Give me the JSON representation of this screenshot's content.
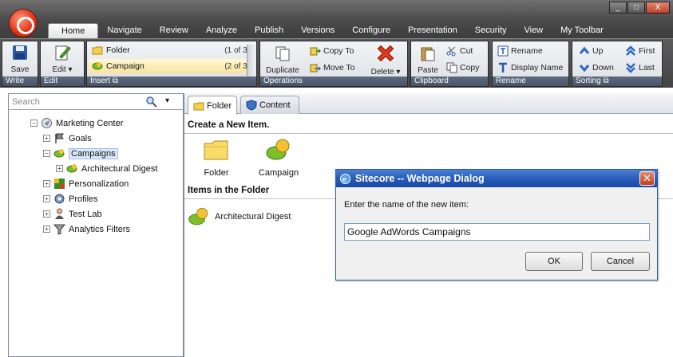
{
  "window": {
    "controls": [
      "_",
      "□",
      "X"
    ]
  },
  "tabs": [
    "Home",
    "Navigate",
    "Review",
    "Analyze",
    "Publish",
    "Versions",
    "Configure",
    "Presentation",
    "Security",
    "View",
    "My Toolbar"
  ],
  "ribbon": {
    "write": {
      "save_label": "Save",
      "footer": "Write"
    },
    "edit": {
      "edit_label": "Edit",
      "footer": "Edit"
    },
    "insert": {
      "footer": "Insert",
      "items": [
        {
          "label": "Folder",
          "count": "(1 of 3)"
        },
        {
          "label": "Campaign",
          "count": "(2 of 3)"
        }
      ]
    },
    "operations": {
      "footer": "Operations",
      "duplicate": "Duplicate",
      "copy_to": "Copy To",
      "move_to": "Move To",
      "delete": "Delete"
    },
    "clipboard": {
      "footer": "Clipboard",
      "paste": "Paste",
      "cut": "Cut",
      "copy": "Copy"
    },
    "rename": {
      "footer": "Rename",
      "rename": "Rename",
      "display_name": "Display Name"
    },
    "sorting": {
      "footer": "Sorting",
      "up": "Up",
      "down": "Down",
      "first": "First",
      "last": "Last"
    }
  },
  "search": {
    "placeholder": "Search"
  },
  "tree": [
    {
      "label": "Marketing Center",
      "expander": "⊟"
    },
    {
      "label": "Goals",
      "expander": "⊞"
    },
    {
      "label": "Campaigns",
      "expander": "⊟"
    },
    {
      "label": "Architectural Digest",
      "expander": "⊞"
    },
    {
      "label": "Personalization",
      "expander": "⊞"
    },
    {
      "label": "Profiles",
      "expander": "⊞"
    },
    {
      "label": "Test Lab",
      "expander": "⊞"
    },
    {
      "label": "Analytics Filters",
      "expander": "⊞"
    }
  ],
  "content_tabs": [
    "Folder",
    "Content"
  ],
  "folder": {
    "create_heading": "Create a New Item.",
    "create_items": [
      "Folder",
      "Campaign"
    ],
    "items_heading": "Items in the Folder",
    "items": [
      "Architectural Digest"
    ]
  },
  "dialog": {
    "title": "Sitecore -- Webpage Dialog",
    "prompt": "Enter the name of the new item:",
    "value": "Google AdWords Campaigns",
    "ok": "OK",
    "cancel": "Cancel"
  }
}
